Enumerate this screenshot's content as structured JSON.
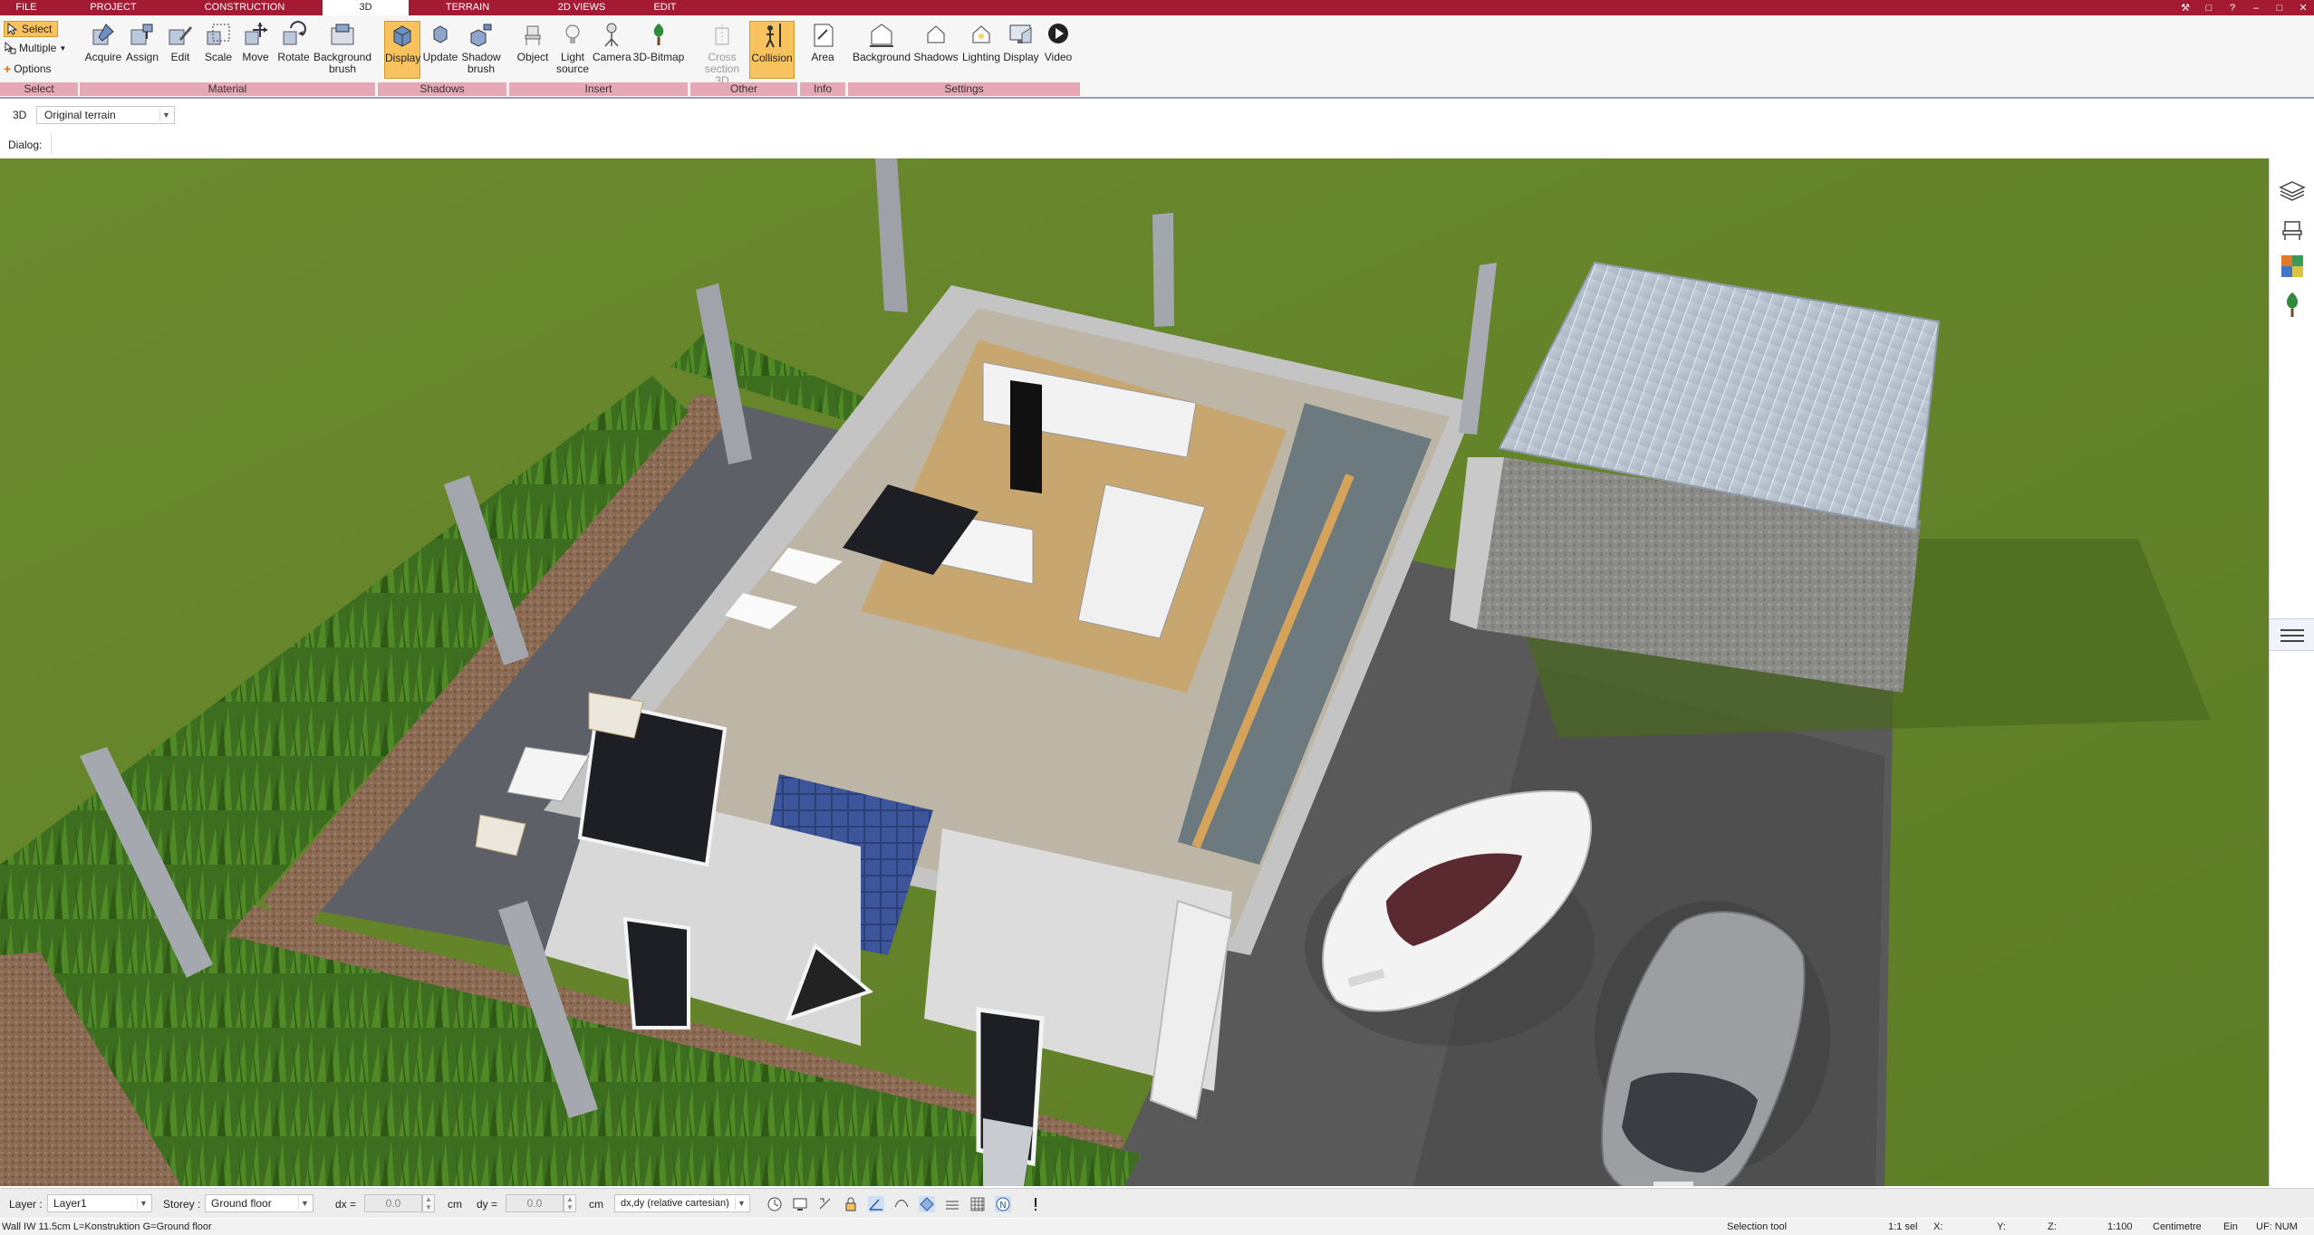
{
  "menubar": {
    "tabs": [
      {
        "label": "FILE"
      },
      {
        "label": "PROJECT"
      },
      {
        "label": "CONSTRUCTION"
      },
      {
        "label": "3D"
      },
      {
        "label": "TERRAIN"
      },
      {
        "label": "2D VIEWS"
      },
      {
        "label": "EDIT"
      }
    ],
    "active_tab": "3D"
  },
  "ribbon": {
    "select": {
      "select_label": "Select",
      "multiple_label": "Multiple",
      "options_label": "Options"
    },
    "material": {
      "acquire": "Acquire",
      "assign": "Assign",
      "edit": "Edit",
      "scale": "Scale",
      "move": "Move",
      "rotate": "Rotate",
      "background_brush_1": "Background",
      "background_brush_2": "brush"
    },
    "shadows": {
      "display": "Display",
      "update": "Update",
      "shadow_brush_1": "Shadow",
      "shadow_brush_2": "brush"
    },
    "insert": {
      "object": "Object",
      "light_source_1": "Light",
      "light_source_2": "source",
      "camera": "Camera",
      "bitmap_3d": "3D-Bitmap"
    },
    "other": {
      "cross_section_1": "Cross",
      "cross_section_2": "section 3D",
      "collision": "Collision"
    },
    "info": {
      "area": "Area"
    },
    "settings": {
      "background": "Background",
      "shadows": "Shadows",
      "lighting": "Lighting",
      "display": "Display",
      "video": "Video"
    },
    "groups": {
      "select": "Select",
      "material": "Material",
      "shadows": "Shadows",
      "insert": "Insert",
      "other": "Other",
      "info": "Info",
      "settings": "Settings"
    }
  },
  "view_bar": {
    "mode_label": "3D",
    "terrain_value": "Original terrain",
    "dialog_label": "Dialog:"
  },
  "bottom_toolbar": {
    "layer_label": "Layer :",
    "layer_value": "Layer1",
    "storey_label": "Storey :",
    "storey_value": "Ground floor",
    "dx_label": "dx =",
    "dx_value": "0.0",
    "dx_unit": "cm",
    "dy_label": "dy =",
    "dy_value": "0.0",
    "dy_unit": "cm",
    "coord_mode": "dx,dy (relative cartesian)"
  },
  "status_bar": {
    "info": "Wall IW 11.5cm L=Konstruktion G=Ground floor",
    "tool": "Selection tool",
    "selection": "1:1 sel",
    "x_label": "X:",
    "y_label": "Y:",
    "z_label": "Z:",
    "scale": "1:100",
    "unit": "Centimetre",
    "mode": "Ein",
    "flags": "UF: NUM"
  },
  "colors": {
    "menubar": "#a41a33",
    "ribbon_group": "#e4a8b6",
    "active_button": "#f8c25e",
    "grass": "#6a8a2c",
    "driveway": "#585858"
  },
  "icons": [
    "select-icon",
    "multiple-icon",
    "options-icon",
    "acquire-icon",
    "assign-icon",
    "edit-icon",
    "scale-icon",
    "move-icon",
    "rotate-icon",
    "background-brush-icon",
    "display-icon",
    "update-icon",
    "shadow-brush-icon",
    "object-icon",
    "light-source-icon",
    "camera-icon",
    "bitmap-3d-icon",
    "cross-section-icon",
    "collision-icon",
    "area-icon",
    "background-icon",
    "shadows-icon",
    "lighting-icon",
    "display-settings-icon",
    "video-icon",
    "layers-icon",
    "furniture-icon",
    "materials-icon",
    "plants-icon"
  ]
}
